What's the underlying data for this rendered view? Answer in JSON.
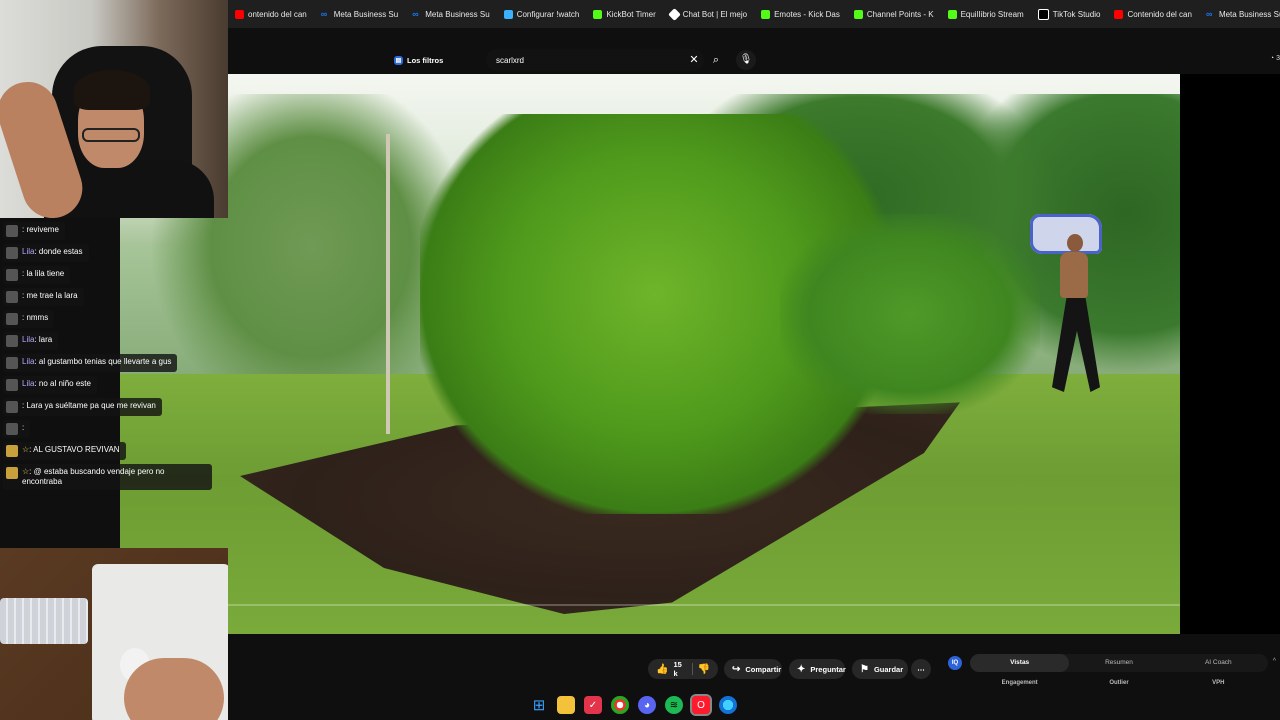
{
  "bookmarks": [
    {
      "label": "ontenido del can",
      "icon": "youtube-icon"
    },
    {
      "label": "Meta Business Su",
      "icon": "meta-icon"
    },
    {
      "label": "Meta Business Su",
      "icon": "meta-icon"
    },
    {
      "label": "Configurar !watch",
      "icon": "config-icon"
    },
    {
      "label": "KickBot Timer",
      "icon": "kick-icon"
    },
    {
      "label": "Chat Bot | El mejo",
      "icon": "chat-icon"
    },
    {
      "label": "Emotes - Kick Das",
      "icon": "kick-icon"
    },
    {
      "label": "Channel Points - K",
      "icon": "kick-icon"
    },
    {
      "label": "EquilIibrio Stream",
      "icon": "kick-icon"
    },
    {
      "label": "TikTok Studio",
      "icon": "tiktok-icon"
    },
    {
      "label": "Contenido del can",
      "icon": "youtube-icon"
    },
    {
      "label": "Meta Business Su",
      "icon": "meta-icon"
    }
  ],
  "header": {
    "filters_label": "Los filtros",
    "search_value": "scarlxrd",
    "clear_glyph": "✕",
    "search_glyph": "⌕",
    "mic_glyph": "🎙",
    "top_right": "◔ 3"
  },
  "chat": [
    {
      "name": "",
      "text": ": reviveme",
      "gold": false
    },
    {
      "name": "Lila",
      "text": ": donde estas",
      "gold": false
    },
    {
      "name": "",
      "text": ": la lila tiene",
      "gold": false
    },
    {
      "name": "",
      "text": ": me trae la lara",
      "gold": false
    },
    {
      "name": "",
      "text": ": nmms",
      "gold": false
    },
    {
      "name": "Lila",
      "text": ": lara",
      "gold": false
    },
    {
      "name": "Lila",
      "text": ": al gustambo tenias que llevarte a gus",
      "gold": false
    },
    {
      "name": "Lila",
      "text": ": no al niño este",
      "gold": false
    },
    {
      "name": "",
      "text": ": Lara ya suéltame pa que me revivan",
      "gold": false
    },
    {
      "name": "",
      "text": ":",
      "gold": false
    },
    {
      "name": "☆",
      "text": ": AL GUSTAVO REVIVAN",
      "gold": true
    },
    {
      "name": "☆",
      "text": ": @ estaba buscando vendaje pero no encontraba",
      "gold": true
    }
  ],
  "actions": {
    "likes": "15 k",
    "like_glyph": "👍",
    "dislike_glyph": "👎",
    "share": "Compartir",
    "share_glyph": "↪",
    "ask": "Preguntar",
    "ask_glyph": "✦",
    "save": "Guardar",
    "save_glyph": "⚑",
    "more_glyph": "⋯"
  },
  "panel": {
    "logo": "IQ",
    "tabs": [
      "Vistas",
      "Resumen",
      "AI Coach"
    ],
    "active_tab": 0,
    "columns": [
      "Engagement",
      "Outlier",
      "VPH"
    ],
    "chevron": "^"
  },
  "taskbar": [
    "windows-start-icon",
    "file-explorer-icon",
    "red-app-icon",
    "chrome-icon",
    "discord-icon",
    "spotify-icon",
    "opera-icon",
    "app-icon"
  ],
  "colors": {
    "accent": "#2d63d8",
    "kick": "#53fc18",
    "youtube": "#ff0000"
  }
}
